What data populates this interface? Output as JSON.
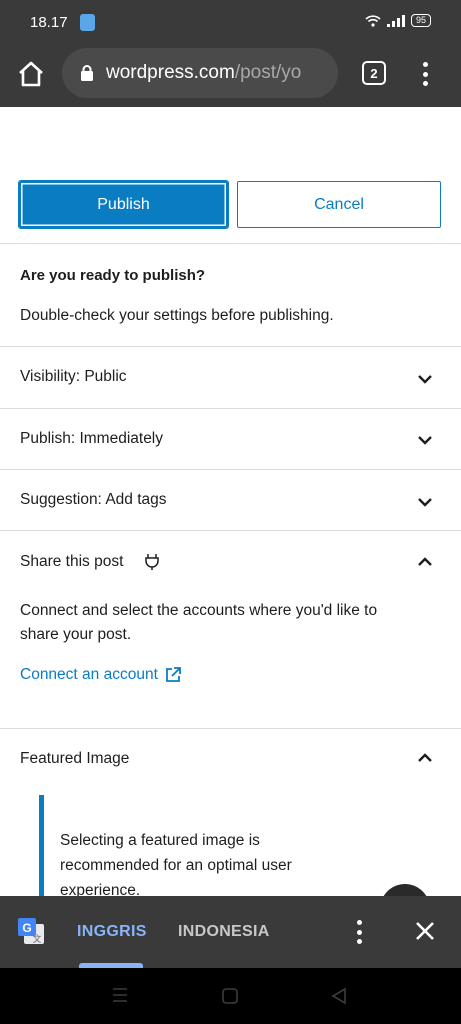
{
  "status": {
    "time": "18.17",
    "battery": "95"
  },
  "browser": {
    "url_host": "wordpress.com",
    "url_path": "/post/yo",
    "tab_count": "2"
  },
  "actions": {
    "publish_label": "Publish",
    "cancel_label": "Cancel"
  },
  "prepublish": {
    "title": "Are you ready to publish?",
    "subtitle": "Double-check your settings before publishing."
  },
  "panels": {
    "visibility": "Visibility: Public",
    "publish_time": "Publish: Immediately",
    "suggestion": "Suggestion: Add tags",
    "share": {
      "title": "Share this post",
      "body": "Connect and select the accounts where you'd like to share your post.",
      "link": "Connect an account"
    },
    "featured": {
      "title": "Featured Image",
      "body": "Selecting a featured image is recommended for an optimal user experience."
    }
  },
  "translate": {
    "source_lang": "INGGRIS",
    "target_lang": "INDONESIA"
  },
  "colors": {
    "accent": "#0a7dc2",
    "chrome_bar": "#3a3a3a",
    "translate_active": "#8ab4f8"
  }
}
